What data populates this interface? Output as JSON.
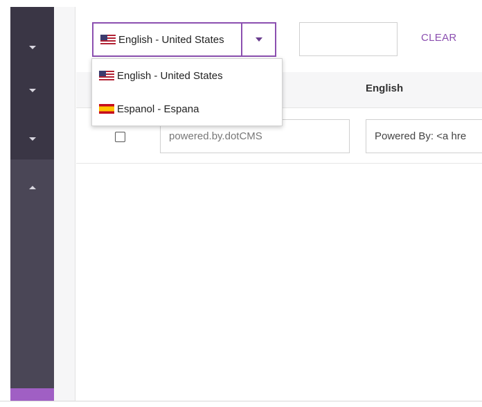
{
  "sidebar": {
    "items": [
      {
        "icon": "chevron-down-icon"
      },
      {
        "icon": "chevron-down-icon"
      },
      {
        "icon": "chevron-down-icon"
      },
      {
        "icon": "chevron-up-icon"
      }
    ],
    "colors": {
      "dark": "#3a3645",
      "base": "#4a4656",
      "accent": "#a05fc4"
    }
  },
  "language_select": {
    "selected": "English - United States",
    "options": [
      {
        "label": "English - United States",
        "flag": "us-flag-icon"
      },
      {
        "label": "Espanol - Espana",
        "flag": "spain-flag-icon"
      }
    ]
  },
  "search": {
    "value": ""
  },
  "toolbar": {
    "clear_label": "CLEAR"
  },
  "table": {
    "columns": [
      "English"
    ],
    "rows": [
      {
        "checked": false,
        "key": "powered.by.dotCMS",
        "value": "Powered By: <a hre"
      }
    ]
  },
  "colors": {
    "accent": "#8b4fb0"
  }
}
